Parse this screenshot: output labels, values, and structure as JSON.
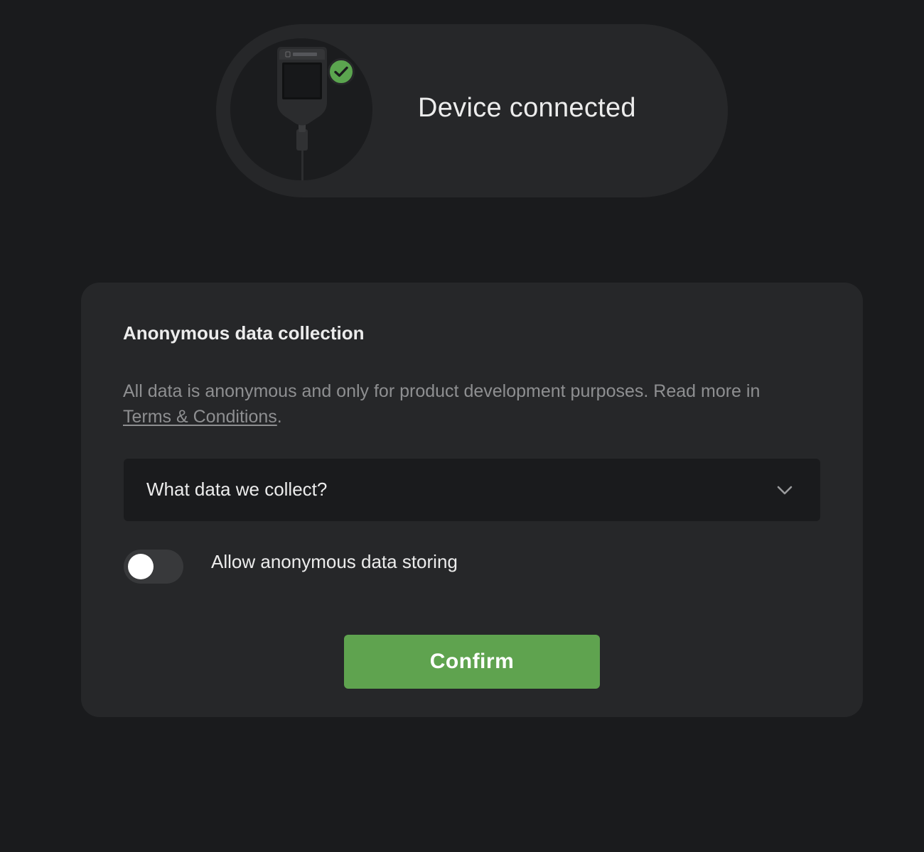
{
  "device": {
    "status": "Device connected",
    "image_icon": "trezor-device-icon",
    "badge_icon": "check-icon",
    "badge_color": "#5ba54f"
  },
  "analytics": {
    "title": "Anonymous data collection",
    "description_prefix": "All data is anonymous and only for product development purposes. Read more in ",
    "terms_link": "Terms & Conditions",
    "description_suffix": ".",
    "collapsible_label": "What data we collect?",
    "collapsible_icon": "chevron-down-icon",
    "toggle_label": "Allow anonymous data storing",
    "toggle_on": false,
    "confirm_label": "Confirm",
    "confirm_color": "#5fa34f"
  }
}
